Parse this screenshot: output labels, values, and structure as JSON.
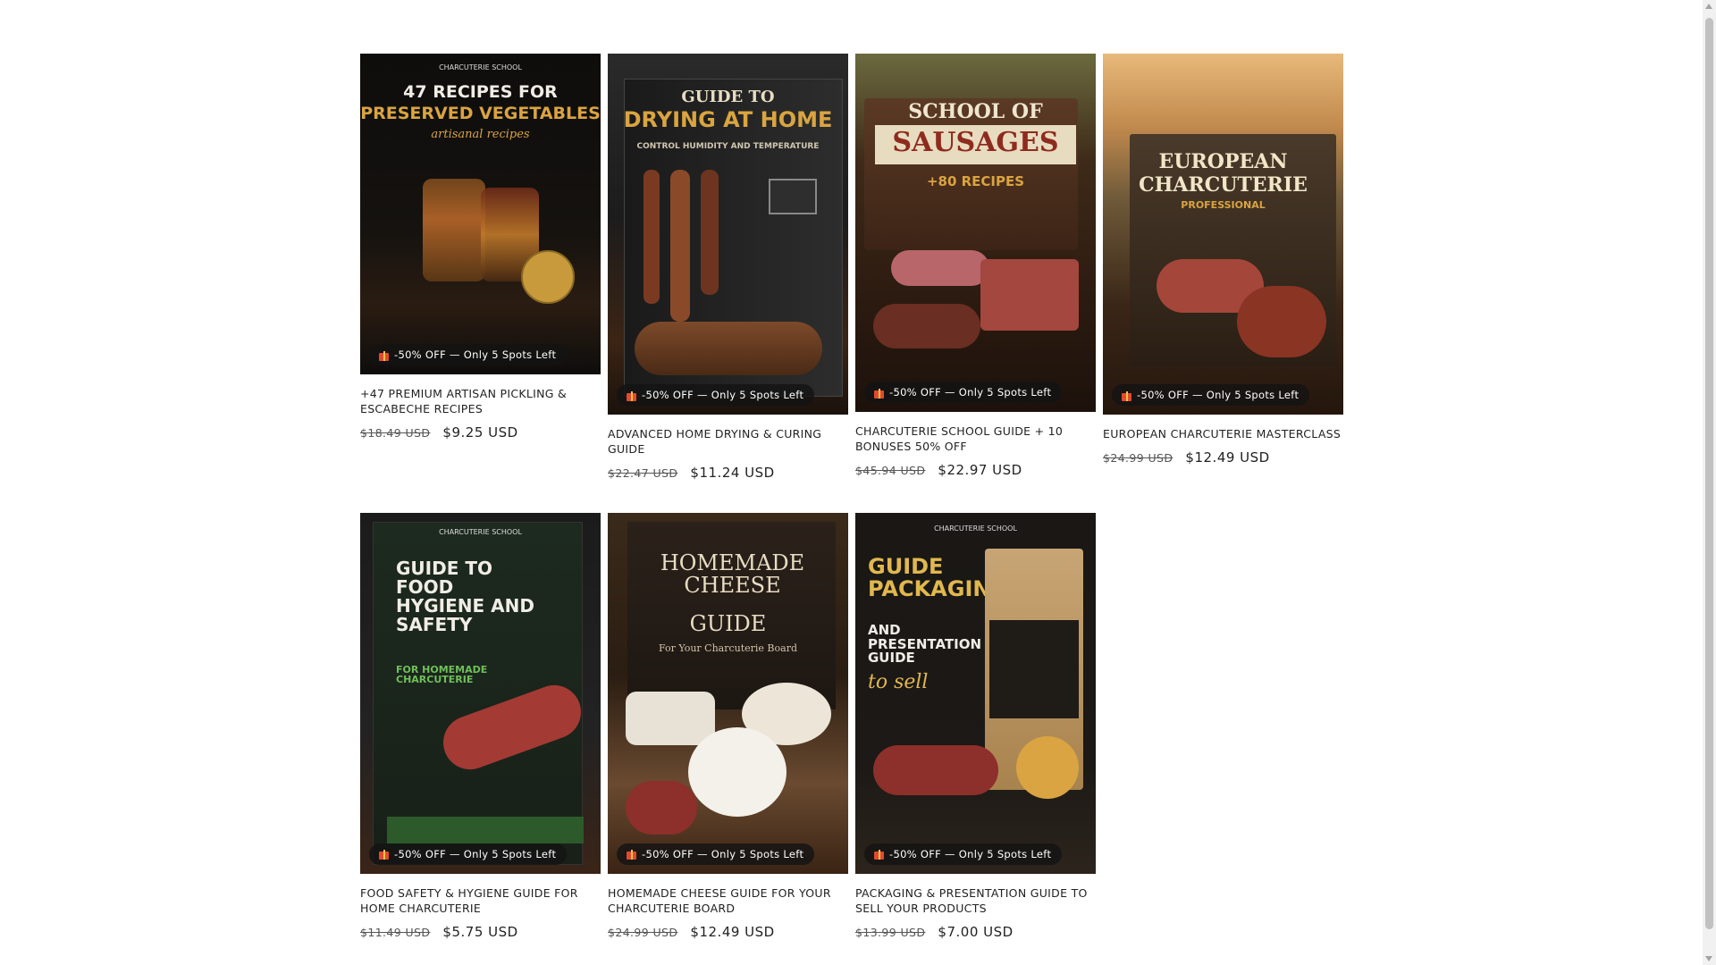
{
  "badge_text": "-50% OFF — Only 5 Spots Left",
  "products": [
    {
      "title": "+47 PREMIUM ARTISAN PICKLING & ESCABECHE RECIPES",
      "old_price": "$18.49 USD",
      "new_price": "$9.25 USD",
      "cover": {
        "top": "CHARCUTERIE SCHOOL",
        "main": "47 RECIPES FOR",
        "sub": "PRESERVED VEGETABLES",
        "tag": "artisanal recipes"
      }
    },
    {
      "title": "ADVANCED HOME DRYING & CURING GUIDE",
      "old_price": "$22.47 USD",
      "new_price": "$11.24 USD",
      "cover": {
        "main": "GUIDE TO",
        "sub": "DRYING AT HOME",
        "tag": "CONTROL HUMIDITY AND TEMPERATURE"
      }
    },
    {
      "title": "CHARCUTERIE SCHOOL GUIDE + 10 BONUSES 50% OFF",
      "old_price": "$45.94 USD",
      "new_price": "$22.97 USD",
      "cover": {
        "main": "SCHOOL OF",
        "sub": "SAUSAGES",
        "tag": "+80 RECIPES"
      }
    },
    {
      "title": "EUROPEAN CHARCUTERIE MASTERCLASS",
      "old_price": "$24.99 USD",
      "new_price": "$12.49 USD",
      "cover": {
        "main": "EUROPEAN",
        "sub": "CHARCUTERIE",
        "tag": "PROFESSIONAL"
      }
    },
    {
      "title": "FOOD SAFETY & HYGIENE GUIDE FOR HOME CHARCUTERIE",
      "old_price": "$11.49 USD",
      "new_price": "$5.75 USD",
      "cover": {
        "top": "CHARCUTERIE SCHOOL",
        "main": "GUIDE TO FOOD HYGIENE AND SAFETY",
        "sub": "FOR HOMEMADE CHARCUTERIE",
        "tag": "FOR HOMEMADE CHARCUTERIE"
      }
    },
    {
      "title": "HOMEMADE CHEESE GUIDE FOR YOUR CHARCUTERIE BOARD",
      "old_price": "$24.99 USD",
      "new_price": "$12.49 USD",
      "cover": {
        "main": "HOMEMADE CHEESE",
        "sub": "GUIDE",
        "tag": "For Your Charcuterie Board"
      }
    },
    {
      "title": "PACKAGING & PRESENTATION GUIDE TO SELL YOUR PRODUCTS",
      "old_price": "$13.99 USD",
      "new_price": "$7.00 USD",
      "cover": {
        "top": "CHARCUTERIE SCHOOL",
        "main": "GUIDE PACKAGING",
        "sub": "AND PRESENTATION GUIDE",
        "tag": "to sell"
      }
    }
  ],
  "colors": {
    "gold": "#d9a441",
    "dark": "#1a1714",
    "wood": "#5a3a22",
    "red": "#8e2b1f"
  }
}
